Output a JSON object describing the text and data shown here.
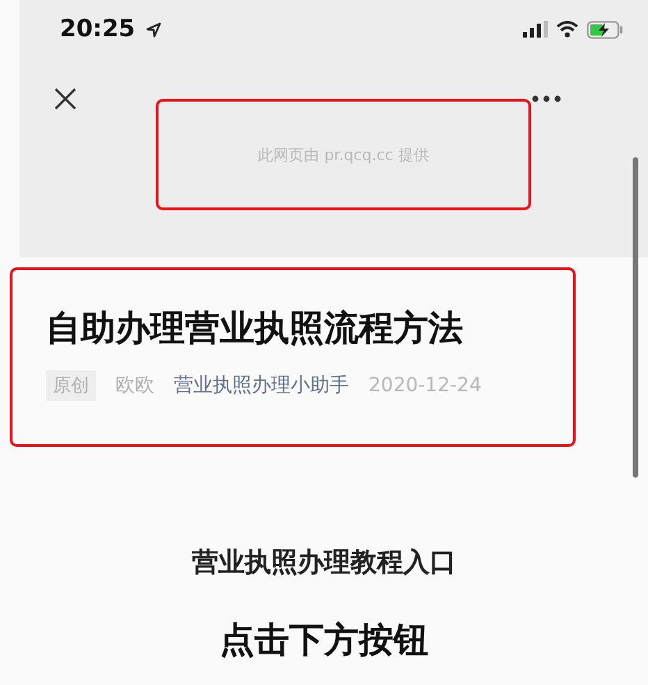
{
  "status_bar": {
    "time": "20:25"
  },
  "provider_notice": {
    "text": "此网页由 pr.qcq.cc 提供",
    "highlighted": true
  },
  "article": {
    "highlighted": true,
    "title": "自助办理营业执照流程方法",
    "tag": "原创",
    "author": "欧欧",
    "account": "营业执照办理小助手",
    "date": "2020-12-24"
  },
  "content": [
    {
      "kind": "subheading",
      "text": "营业执照办理教程入口"
    },
    {
      "kind": "heading",
      "text": "点击下方按钮"
    }
  ]
}
